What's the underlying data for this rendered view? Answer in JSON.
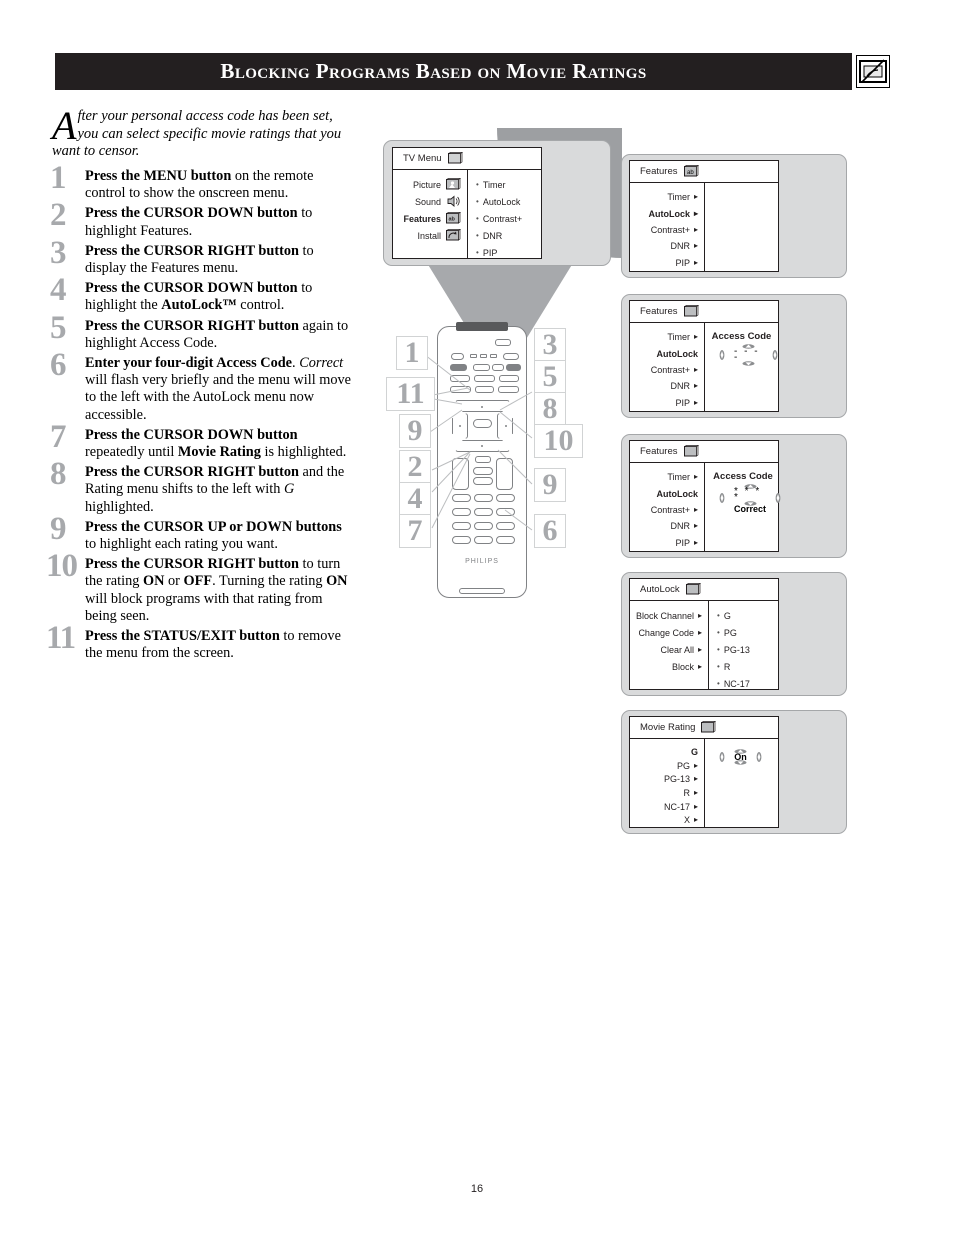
{
  "header": {
    "title": "Blocking Programs Based on Movie Ratings",
    "icon": "blocked-tv-icon"
  },
  "intro": {
    "dropcap": "A",
    "text": "fter your personal access code has been set, you can select specific movie ratings that you want to censor."
  },
  "steps": [
    {
      "num": "1",
      "html": "<b>Press the MENU button</b> on the remote control to show the onscreen menu."
    },
    {
      "num": "2",
      "html": "<b>Press the CURSOR DOWN button</b> to highlight Features."
    },
    {
      "num": "3",
      "html": "<b>Press the CURSOR RIGHT button</b> to display the Features menu."
    },
    {
      "num": "4",
      "html": "<b>Press the CURSOR DOWN button</b> to highlight the <b>AutoLock&trade;</b> control."
    },
    {
      "num": "5",
      "html": "<b>Press the CURSOR RIGHT button</b> again to highlight Access Code."
    },
    {
      "num": "6",
      "html": "<b>Enter your four-digit Access Code</b>. <i>Correct</i> will flash very briefly and the menu will move to the left with the AutoLock menu now accessible."
    },
    {
      "num": "7",
      "html": "<b>Press the CURSOR DOWN button</b> repeatedly until <b>Movie Rating</b> is highlighted."
    },
    {
      "num": "8",
      "html": "<b>Press the CURSOR RIGHT button</b> and the Rating menu shifts to the left with <i>G</i> highlighted."
    },
    {
      "num": "9",
      "html": "<b>Press the CURSOR UP or DOWN buttons</b> to highlight each rating you want."
    },
    {
      "num": "10",
      "html": "<b>Press the CURSOR RIGHT button</b> to turn the rating <b>ON</b> or <b>OFF</b>. Turning the rating <b>ON</b> will block programs with that rating from being seen."
    },
    {
      "num": "11",
      "html": "<b>Press the STATUS/EXIT button</b> to remove the menu from the screen."
    }
  ],
  "tv_menu": {
    "title": "TV Menu",
    "title_icon": "tv-icon",
    "left_items": [
      {
        "label": "Picture",
        "icon": "picture-icon",
        "selected": false
      },
      {
        "label": "Sound",
        "icon": "sound-icon",
        "selected": false
      },
      {
        "label": "Features",
        "icon": "features-icon",
        "selected": true
      },
      {
        "label": "Install",
        "icon": "install-icon",
        "selected": false
      }
    ],
    "right_items": [
      "Timer",
      "AutoLock",
      "Contrast+",
      "DNR",
      "PIP"
    ]
  },
  "panels": [
    {
      "id": "features-1",
      "title": "Features",
      "title_icon": "features-icon",
      "left_items": [
        {
          "label": "Timer",
          "selected": false
        },
        {
          "label": "AutoLock",
          "selected": true
        },
        {
          "label": "Contrast+",
          "selected": false
        },
        {
          "label": "DNR",
          "selected": false
        },
        {
          "label": "PIP",
          "selected": false
        }
      ],
      "right_header": "",
      "right_value": "",
      "right_caption": "",
      "show_cursors": false
    },
    {
      "id": "features-2",
      "title": "Features",
      "title_icon": "features-icon",
      "left_items": [
        {
          "label": "Timer",
          "selected": false
        },
        {
          "label": "AutoLock",
          "selected": true
        },
        {
          "label": "Contrast+",
          "selected": false
        },
        {
          "label": "DNR",
          "selected": false
        },
        {
          "label": "PIP",
          "selected": false
        }
      ],
      "right_header": "Access Code",
      "right_value": "- - - -",
      "right_caption": "",
      "show_cursors": true
    },
    {
      "id": "features-3",
      "title": "Features",
      "title_icon": "features-icon",
      "left_items": [
        {
          "label": "Timer",
          "selected": false
        },
        {
          "label": "AutoLock",
          "selected": true
        },
        {
          "label": "Contrast+",
          "selected": false
        },
        {
          "label": "DNR",
          "selected": false
        },
        {
          "label": "PIP",
          "selected": false
        }
      ],
      "right_header": "Access Code",
      "right_value": "* * * *",
      "right_caption": "Correct",
      "show_cursors": true
    }
  ],
  "autolock_panel": {
    "title": "AutoLock",
    "title_icon": "features-icon",
    "left_items": [
      "Block Channel",
      "Change Code",
      "Clear All",
      "Block"
    ],
    "right_items": [
      "G",
      "PG",
      "PG-13",
      "R",
      "NC-17"
    ]
  },
  "movie_rating_panel": {
    "title": "Movie Rating",
    "title_icon": "features-icon",
    "items": [
      {
        "label": "G",
        "selected": true
      },
      {
        "label": "PG",
        "selected": false
      },
      {
        "label": "PG-13",
        "selected": false
      },
      {
        "label": "R",
        "selected": false
      },
      {
        "label": "NC-17",
        "selected": false
      },
      {
        "label": "X",
        "selected": false
      }
    ],
    "value": "On"
  },
  "remote": {
    "brand": "PHILIPS",
    "callouts_left": [
      "1",
      "11",
      "9",
      "2",
      "4",
      "7"
    ],
    "callouts_right": [
      "3",
      "5",
      "8",
      "10",
      "9",
      "6"
    ]
  },
  "page_number": "16",
  "colors": {
    "header_bg": "#231f20",
    "callout_gray": "#a7a9ac",
    "bezel_gray": "#d9dadb",
    "cone_gray": "#a7a9ac"
  }
}
